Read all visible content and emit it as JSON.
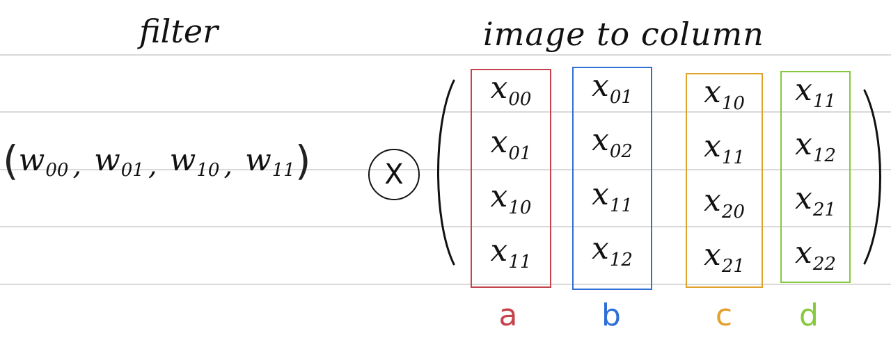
{
  "headings": {
    "filter": "filter",
    "im2col": "image to column"
  },
  "filter_vector": {
    "open": "(",
    "close": ")",
    "comma": ",",
    "weights": [
      {
        "base": "w",
        "sub": "00"
      },
      {
        "base": "w",
        "sub": "01"
      },
      {
        "base": "w",
        "sub": "10"
      },
      {
        "base": "w",
        "sub": "11"
      }
    ]
  },
  "operator": {
    "symbol": "X"
  },
  "columns": [
    {
      "label": "a",
      "color": "#c4444d",
      "entries": [
        {
          "base": "x",
          "sub": "00"
        },
        {
          "base": "x",
          "sub": "01"
        },
        {
          "base": "x",
          "sub": "10"
        },
        {
          "base": "x",
          "sub": "11"
        }
      ]
    },
    {
      "label": "b",
      "color": "#2f6fd6",
      "entries": [
        {
          "base": "x",
          "sub": "01"
        },
        {
          "base": "x",
          "sub": "02"
        },
        {
          "base": "x",
          "sub": "11"
        },
        {
          "base": "x",
          "sub": "12"
        }
      ]
    },
    {
      "label": "c",
      "color": "#e2a12b",
      "entries": [
        {
          "base": "x",
          "sub": "10"
        },
        {
          "base": "x",
          "sub": "11"
        },
        {
          "base": "x",
          "sub": "20"
        },
        {
          "base": "x",
          "sub": "21"
        }
      ]
    },
    {
      "label": "d",
      "color": "#86c93d",
      "entries": [
        {
          "base": "x",
          "sub": "11"
        },
        {
          "base": "x",
          "sub": "12"
        },
        {
          "base": "x",
          "sub": "21"
        },
        {
          "base": "x",
          "sub": "22"
        }
      ]
    }
  ]
}
